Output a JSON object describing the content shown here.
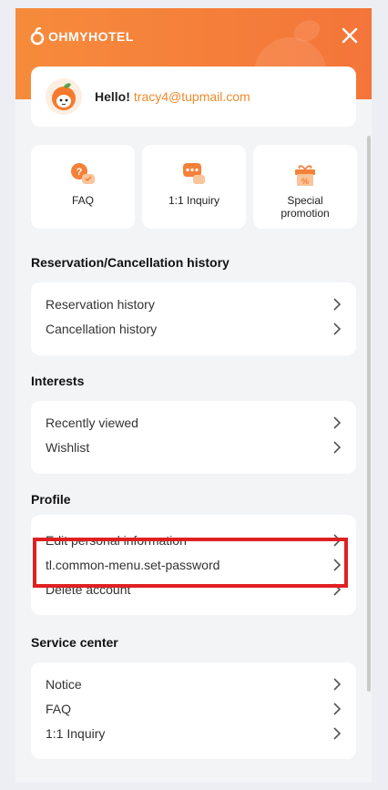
{
  "header": {
    "brand": "OHMYHOTEL",
    "greeting": "Hello!",
    "email": "tracy4@tupmail.com"
  },
  "quick_links": [
    {
      "label": "FAQ",
      "icon": "faq-bubble-icon"
    },
    {
      "label": "1:1 Inquiry",
      "icon": "chat-bubble-icon"
    },
    {
      "label": "Special promotion",
      "icon": "gift-icon"
    }
  ],
  "sections": [
    {
      "title": "Reservation/Cancellation history",
      "items": [
        "Reservation history",
        "Cancellation history"
      ]
    },
    {
      "title": "Interests",
      "items": [
        "Recently viewed",
        "Wishlist"
      ]
    },
    {
      "title": "Profile",
      "items": [
        "Edit personal information",
        "tl.common-menu.set-password",
        "Delete account"
      ]
    },
    {
      "title": "Service center",
      "items": [
        "Notice",
        "FAQ",
        "1:1 Inquiry"
      ]
    }
  ],
  "colors": {
    "accent": "#f4813a",
    "email": "#f08a2b",
    "highlight": "#e02020"
  }
}
